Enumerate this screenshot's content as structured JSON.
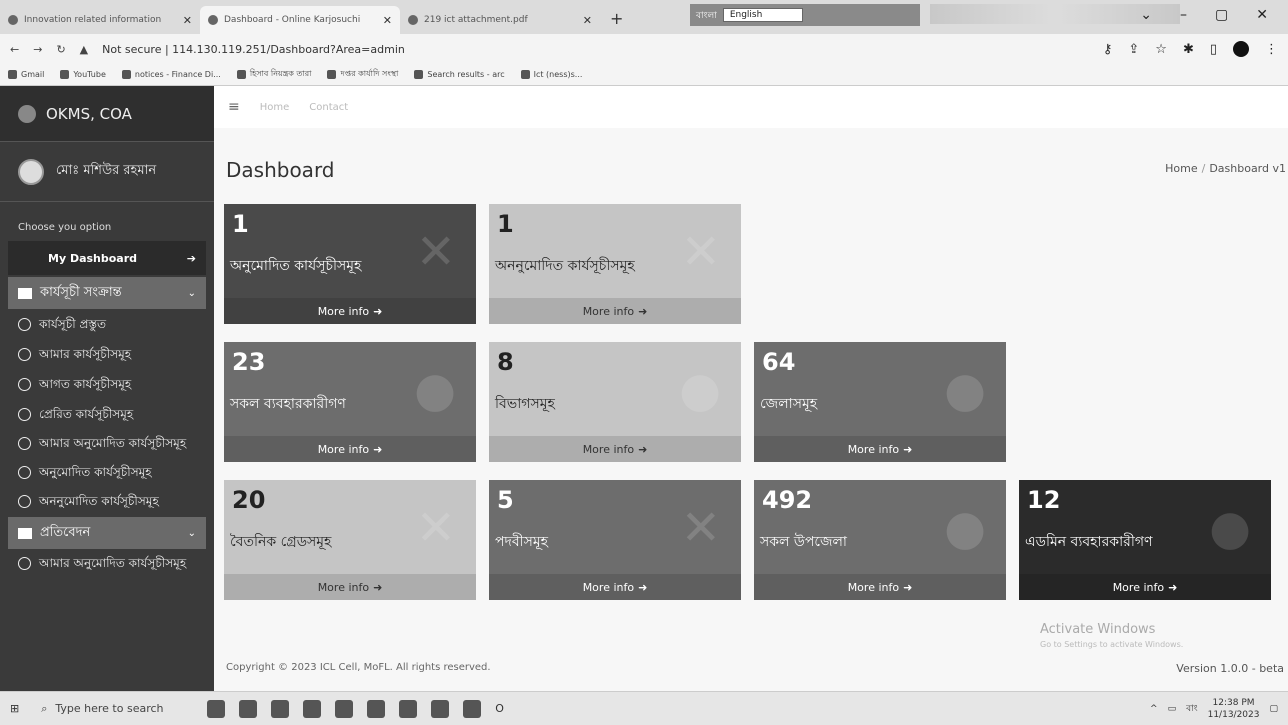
{
  "browser": {
    "tabs": [
      {
        "label": "Innovation related information"
      },
      {
        "label": "Dashboard - Online Karjosuchi"
      },
      {
        "label": "219 ict attachment.pdf"
      }
    ],
    "new_tab": "+",
    "lang_label": "বাংলা",
    "lang_value": "English",
    "address": "Not secure | 114.130.119.251/Dashboard?Area=admin",
    "bookmarks": [
      "Gmail",
      "YouTube",
      "notices - Finance Di...",
      "হিসাব নিয়ন্ত্রক তারা",
      "দপ্তর কার্যাদি সংস্থা",
      "Search results - arc",
      "Ict (ness)s..."
    ]
  },
  "sidebar": {
    "brand": "OKMS, COA",
    "user_name": "মোঃ মশিউর রহমান",
    "caption": "Choose you option",
    "dashboard_label": "My Dashboard",
    "section1": "কার্যসূচী সংক্রান্ত",
    "items": [
      "কার্যসূচী প্রস্তুত",
      "আমার কার্যসূচীসমূহ",
      "আগত কার্যসূচীসমূহ",
      "প্রেরিত কার্যসূচীসমূহ",
      "আমার অনুমোদিত কার্যসূচীসমূহ",
      "অনুমোদিত কার্যসূচীসমূহ",
      "অননুমোদিত কার্যসূচীসমূহ"
    ],
    "section2": "প্রতিবেদন",
    "items2": [
      "আমার অনুমোদিত কার্যসূচীসমূহ"
    ]
  },
  "topnav": {
    "home": "Home",
    "contact": "Contact"
  },
  "page": {
    "title": "Dashboard",
    "breadcrumb_home": "Home",
    "breadcrumb_current": "Dashboard v1"
  },
  "cards": [
    {
      "value": "1",
      "label": "অনুমোদিত কার্যসূচীসমূহ",
      "more": "More info"
    },
    {
      "value": "1",
      "label": "অননুমোদিত কার্যসূচীসমূহ",
      "more": "More info"
    },
    {
      "value": "23",
      "label": "সকল ব্যবহারকারীগণ",
      "more": "More info"
    },
    {
      "value": "8",
      "label": "বিভাগসমূহ",
      "more": "More info"
    },
    {
      "value": "64",
      "label": "জেলাসমূহ",
      "more": "More info"
    },
    {
      "value": "20",
      "label": "বৈতনিক গ্রেডসমূহ",
      "more": "More info"
    },
    {
      "value": "5",
      "label": "পদবীসমূহ",
      "more": "More info"
    },
    {
      "value": "492",
      "label": "সকল উপজেলা",
      "more": "More info"
    },
    {
      "value": "12",
      "label": "এডমিন ব্যবহারকারীগণ",
      "more": "More info"
    }
  ],
  "footer": {
    "copyright": "Copyright © 2023 ICL Cell, MoFL. All rights reserved.",
    "version": "Version 1.0.0 - beta",
    "activate_title": "Activate Windows",
    "activate_sub": "Go to Settings to activate Windows."
  },
  "taskbar": {
    "search_placeholder": "Type here to search",
    "time": "12:38 PM",
    "date": "11/13/2023",
    "lang": "বাং"
  }
}
